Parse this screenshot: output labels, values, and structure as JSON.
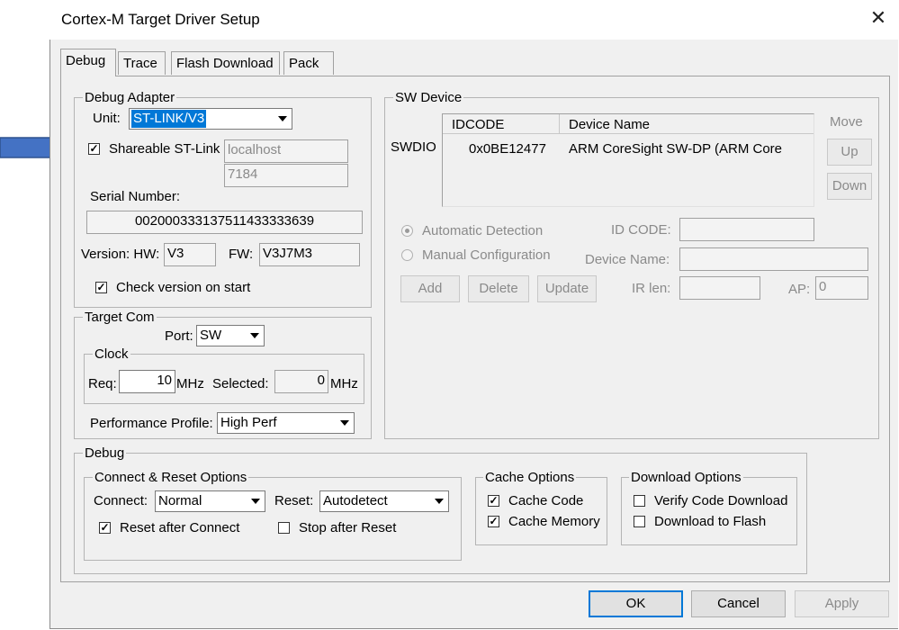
{
  "window": {
    "title": "Cortex-M Target Driver Setup",
    "close_glyph": "✕"
  },
  "tabs": [
    {
      "label": "Debug",
      "active": true
    },
    {
      "label": "Trace",
      "active": false
    },
    {
      "label": "Flash Download",
      "active": false
    },
    {
      "label": "Pack",
      "active": false
    }
  ],
  "debug_adapter": {
    "legend": "Debug Adapter",
    "unit_label": "Unit:",
    "unit_value": "ST-LINK/V3",
    "shareable_label": "Shareable ST-Link",
    "shareable_checked": true,
    "host_value": "localhost",
    "port_value": "7184",
    "serial_label": "Serial Number:",
    "serial_value": "002000333137511433333639",
    "version_label": "Version: HW:",
    "hw_value": "V3",
    "fw_label": "FW:",
    "fw_value": "V3J7M3",
    "check_version_label": "Check version on start",
    "check_version_checked": true
  },
  "target_com": {
    "legend": "Target Com",
    "port_label": "Port:",
    "port_value": "SW",
    "clock_legend": "Clock",
    "req_label": "Req:",
    "req_value": "10",
    "req_unit": "MHz",
    "selected_label": "Selected:",
    "selected_value": "0",
    "selected_unit": "MHz",
    "perf_label": "Performance Profile:",
    "perf_value": "High Perf"
  },
  "sw_device": {
    "legend": "SW Device",
    "swdio_label": "SWDIO",
    "columns": [
      "IDCODE",
      "Device Name"
    ],
    "rows": [
      {
        "idcode": "0x0BE12477",
        "device_name": "ARM CoreSight SW-DP (ARM Core"
      }
    ],
    "move_label": "Move",
    "up_label": "Up",
    "down_label": "Down",
    "auto_detect_label": "Automatic Detection",
    "manual_config_label": "Manual Configuration",
    "id_code_label": "ID CODE:",
    "device_name_label": "Device Name:",
    "add_label": "Add",
    "delete_label": "Delete",
    "update_label": "Update",
    "ir_len_label": "IR len:",
    "ap_label": "AP:",
    "ap_value": "0"
  },
  "debug": {
    "legend": "Debug",
    "connect_reset_legend": "Connect & Reset Options",
    "connect_label": "Connect:",
    "connect_value": "Normal",
    "reset_label": "Reset:",
    "reset_value": "Autodetect",
    "reset_after_connect_label": "Reset after Connect",
    "reset_after_connect_checked": true,
    "stop_after_reset_label": "Stop after Reset",
    "stop_after_reset_checked": false,
    "cache_legend": "Cache Options",
    "cache_code_label": "Cache Code",
    "cache_code_checked": true,
    "cache_memory_label": "Cache Memory",
    "cache_memory_checked": true,
    "download_legend": "Download Options",
    "verify_label": "Verify Code Download",
    "verify_checked": false,
    "download_flash_label": "Download to Flash",
    "download_flash_checked": false
  },
  "footer": {
    "ok_label": "OK",
    "cancel_label": "Cancel",
    "apply_label": "Apply"
  },
  "check_glyph": "✓",
  "annotation": {
    "arrow_color": "#4472c4",
    "icon": "arrow-right-icon"
  }
}
